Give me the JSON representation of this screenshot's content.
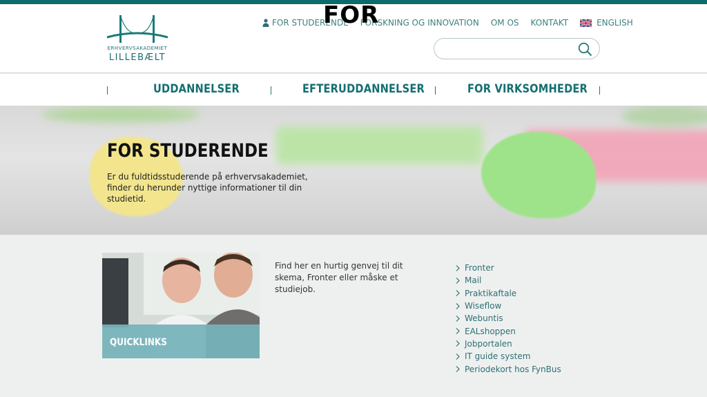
{
  "colors": {
    "brand": "#0c6b6b",
    "nav_text": "#156f70",
    "link": "#2f6f73",
    "card_overlay": "#76b3ba",
    "background": "#eef0f0"
  },
  "logo": {
    "line1": "ERHVERVSAKADEMIET",
    "line2": "LILLEBÆLT"
  },
  "overlay_text": "FOR",
  "topnav": {
    "items": [
      {
        "label": "FOR STUDERENDE",
        "icon": "user-icon"
      },
      {
        "label": "FORSKNING OG INNOVATION"
      },
      {
        "label": "OM OS"
      },
      {
        "label": "KONTAKT"
      },
      {
        "label": "ENGLISH",
        "icon": "uk-flag-icon"
      }
    ]
  },
  "search": {
    "placeholder": "",
    "value": "",
    "icon": "search-icon"
  },
  "mainnav": {
    "items": [
      "UDDANNELSER",
      "EFTERUDDANNELSER",
      "FOR VIRKSOMHEDER"
    ]
  },
  "hero": {
    "title": "FOR STUDERENDE",
    "text": "Er du fuldtidsstuderende på erhvervsakademiet, finder du herunder nyttige informationer til din studietid."
  },
  "card": {
    "label": "QUICKLINKS"
  },
  "intro": "Find her en hurtig genvej til dit skema, Fronter eller måske et studiejob.",
  "quicklinks": [
    "Fronter",
    "Mail",
    "Praktikaftale",
    "Wiseflow",
    "Webuntis",
    "EALshoppen",
    "Jobportalen",
    "IT guide system",
    "Periodekort hos FynBus"
  ]
}
